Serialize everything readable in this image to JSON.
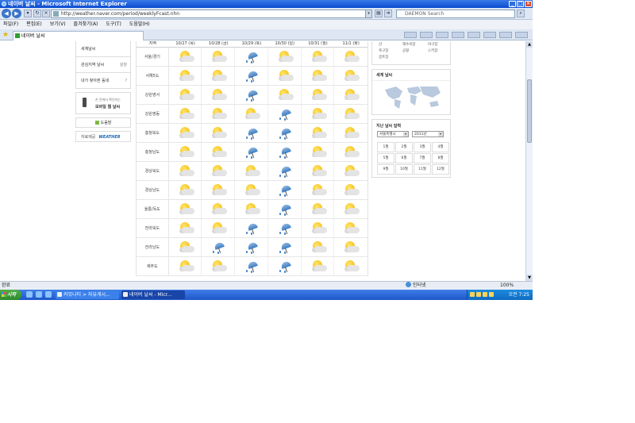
{
  "window": {
    "title": "네이버 날씨 - Microsoft Internet Explorer"
  },
  "address_bar": {
    "url": "http://weather.naver.com/period/weeklyFcast.nhn",
    "search_placeholder": "DAEMON Search"
  },
  "menu": [
    "파일(F)",
    "편집(E)",
    "보기(V)",
    "즐겨찾기(A)",
    "도구(T)",
    "도움말(H)"
  ],
  "tab": {
    "label": "네이버 날씨"
  },
  "sidebar": {
    "items": [
      {
        "label": "세계날씨"
      },
      {
        "label": "관심지역 날씨",
        "right": "설정"
      },
      {
        "label": "내가 찾아본 동네",
        "right": "?"
      }
    ],
    "mobile_small": "손 안에서 확인하는",
    "mobile_title": "모바일 웹 날씨",
    "help": "도움말",
    "source_label": "자료제공",
    "source_brand": "WEATHER"
  },
  "forecast": {
    "header": {
      "region": "지역",
      "days": [
        "10/27 (목)",
        "10/28 (금)",
        "10/29 (토)",
        "10/30 (일)",
        "10/31 (월)",
        "11/1 (화)"
      ]
    },
    "rows": [
      {
        "region": "서울/경기",
        "icons": [
          "sun-cloud",
          "sun-cloud",
          "umbrella",
          "sun-cloud",
          "sun-cloud",
          "sun-cloud"
        ]
      },
      {
        "region": "서해5도",
        "icons": [
          "sun-cloud",
          "sun-cloud",
          "umbrella",
          "sun-cloud",
          "sun-cloud",
          "sun-cloud"
        ]
      },
      {
        "region": "강원영서",
        "icons": [
          "sun-cloud",
          "sun-cloud",
          "umbrella",
          "sun-cloud",
          "sun-cloud",
          "sun-cloud"
        ]
      },
      {
        "region": "강원영동",
        "icons": [
          "sun-cloud",
          "sun-cloud",
          "sun-cloud",
          "umbrella",
          "sun-cloud",
          "sun-cloud"
        ]
      },
      {
        "region": "충청북도",
        "icons": [
          "sun-cloud",
          "sun-cloud",
          "umbrella",
          "umbrella",
          "sun-cloud",
          "sun-cloud"
        ]
      },
      {
        "region": "충청남도",
        "icons": [
          "sun-cloud",
          "sun-cloud",
          "umbrella",
          "umbrella",
          "sun-cloud",
          "sun-cloud"
        ]
      },
      {
        "region": "경상북도",
        "icons": [
          "sun-cloud",
          "sun-cloud",
          "sun-cloud",
          "umbrella",
          "sun-cloud",
          "sun-cloud"
        ]
      },
      {
        "region": "경상남도",
        "icons": [
          "sun-cloud",
          "sun-cloud",
          "sun-cloud",
          "umbrella",
          "sun-cloud",
          "sun-cloud"
        ]
      },
      {
        "region": "울릉/독도",
        "icons": [
          "sun-cloud",
          "sun-cloud",
          "sun-cloud",
          "umbrella",
          "sun-cloud",
          "sun-cloud"
        ]
      },
      {
        "region": "전라북도",
        "icons": [
          "sun-cloud",
          "sun-cloud",
          "umbrella",
          "umbrella",
          "sun-cloud",
          "sun-cloud"
        ]
      },
      {
        "region": "전라남도",
        "icons": [
          "sun-cloud",
          "umbrella",
          "umbrella",
          "umbrella",
          "sun-cloud",
          "sun-cloud"
        ]
      },
      {
        "region": "제주도",
        "icons": [
          "sun-cloud",
          "sun-cloud",
          "umbrella",
          "umbrella",
          "sun-cloud",
          "sun-cloud"
        ]
      }
    ]
  },
  "right": {
    "links": [
      "산",
      "해수욕장",
      "야구장",
      "축구장",
      "공항",
      "스키장",
      "골프장"
    ],
    "world_title": "세계 날씨",
    "past_title": "지난 날씨 달력",
    "city_select": "서울특별시",
    "year_select": "2011년",
    "months": [
      "1월",
      "2월",
      "3월",
      "4월",
      "5월",
      "6월",
      "7월",
      "8월",
      "9월",
      "10월",
      "11월",
      "12월"
    ]
  },
  "status": {
    "text": "완료",
    "zone": "인터넷",
    "zoom": "100%"
  },
  "taskbar": {
    "start": "시작",
    "tasks": [
      "커뮤니티 > 자유게시...",
      "네이버 날씨 - Micr..."
    ],
    "clock": "오전 7:25"
  },
  "colors": {
    "titlebar": "#0a4bd0",
    "taskbar": "#1e56c9",
    "start": "#2e8a2d",
    "sun": "#f2b400",
    "rain": "#3f7fc4"
  }
}
